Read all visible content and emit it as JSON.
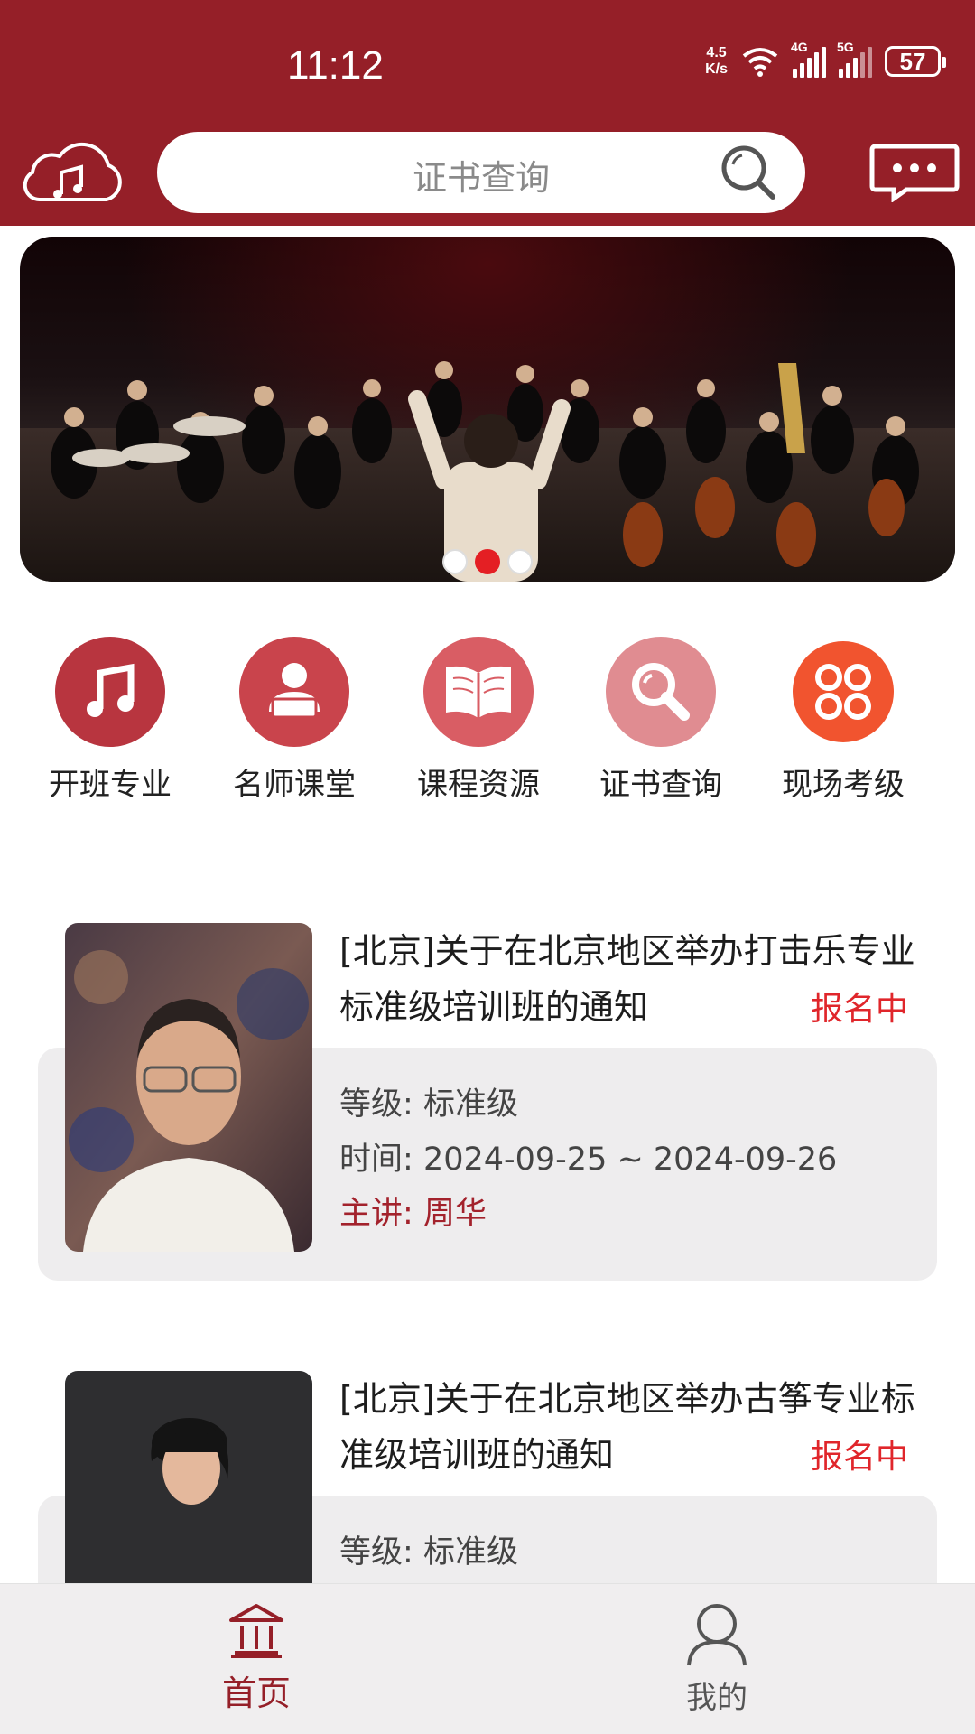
{
  "status_bar": {
    "time": "11:12",
    "speed_top": "4.5",
    "speed_bottom": "K/s",
    "net1": "4G",
    "net2": "5G",
    "battery": "57"
  },
  "header": {
    "search_placeholder": "证书查询",
    "colors": {
      "brand": "#951f28"
    }
  },
  "banner": {
    "dots": 3,
    "active_index": 1
  },
  "menu": [
    {
      "label": "开班专业",
      "icon": "music-note-icon",
      "color": "#b8353f"
    },
    {
      "label": "名师课堂",
      "icon": "teacher-reading-icon",
      "color": "#c9444c"
    },
    {
      "label": "课程资源",
      "icon": "open-book-icon",
      "color": "#d95d64"
    },
    {
      "label": "证书查询",
      "icon": "magnifier-icon",
      "color": "#e08c91"
    },
    {
      "label": "现场考级",
      "icon": "four-circles-icon",
      "color": "#f1542f"
    }
  ],
  "courses": [
    {
      "title": "[北京]关于在北京地区举办打击乐专业标准级培训班的通知",
      "status": "报名中",
      "level_label": "等级:",
      "level": "标准级",
      "time_label": "时间:",
      "time": "2024-09-25 ~ 2024-09-26",
      "lecturer_label": "主讲:",
      "lecturer": "周华"
    },
    {
      "title": "[北京]关于在北京地区举办古筝专业标准级培训班的通知",
      "status": "报名中",
      "level_label": "等级:",
      "level": "标准级"
    }
  ],
  "bottom_nav": [
    {
      "label": "首页",
      "icon": "home-building-icon",
      "active": true
    },
    {
      "label": "我的",
      "icon": "user-icon",
      "active": false
    }
  ]
}
